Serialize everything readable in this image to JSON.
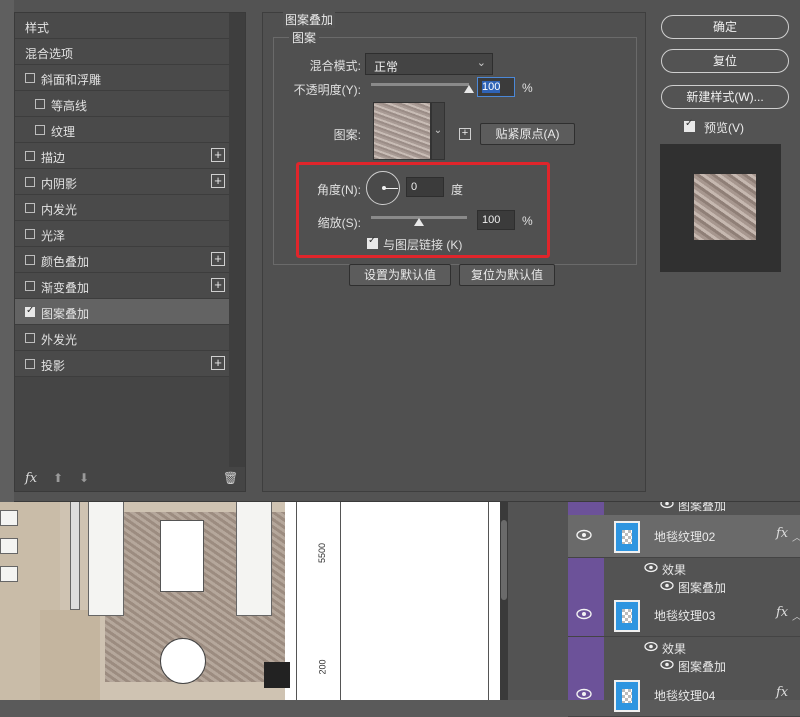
{
  "canvas": {
    "dimension_labels": [
      "5500",
      "200"
    ]
  },
  "layers": {
    "items": [
      {
        "name": "地毯纹理02",
        "fx": "fx",
        "effects_label": "效果",
        "effect": "图案叠加"
      },
      {
        "name": "地毯纹理03",
        "fx": "fx",
        "effects_label": "效果",
        "effect": "图案叠加"
      },
      {
        "name": "地毯纹理04",
        "fx": "fx"
      }
    ],
    "top_partial_effect": "图案叠加"
  },
  "styles_list": {
    "items": [
      {
        "label": "样式",
        "checkbox": "none",
        "plus": false,
        "indent": 0
      },
      {
        "label": "混合选项",
        "checkbox": "none",
        "plus": false,
        "indent": 0
      },
      {
        "label": "斜面和浮雕",
        "checkbox": "unchecked",
        "plus": false,
        "indent": 0
      },
      {
        "label": "等高线",
        "checkbox": "unchecked",
        "plus": false,
        "indent": 1
      },
      {
        "label": "纹理",
        "checkbox": "unchecked",
        "plus": false,
        "indent": 1
      },
      {
        "label": "描边",
        "checkbox": "unchecked",
        "plus": true,
        "indent": 0
      },
      {
        "label": "内阴影",
        "checkbox": "unchecked",
        "plus": true,
        "indent": 0
      },
      {
        "label": "内发光",
        "checkbox": "unchecked",
        "plus": false,
        "indent": 0
      },
      {
        "label": "光泽",
        "checkbox": "unchecked",
        "plus": false,
        "indent": 0
      },
      {
        "label": "颜色叠加",
        "checkbox": "unchecked",
        "plus": true,
        "indent": 0
      },
      {
        "label": "渐变叠加",
        "checkbox": "unchecked",
        "plus": true,
        "indent": 0
      },
      {
        "label": "图案叠加",
        "checkbox": "checked",
        "plus": false,
        "indent": 0,
        "active": true
      },
      {
        "label": "外发光",
        "checkbox": "unchecked",
        "plus": false,
        "indent": 0
      },
      {
        "label": "投影",
        "checkbox": "unchecked",
        "plus": true,
        "indent": 0
      }
    ],
    "footer": {
      "fx": "fx",
      "up": "⬆",
      "down": "⬇",
      "trash": "🗑"
    }
  },
  "settings": {
    "group_title": "图案叠加",
    "fieldset_title": "图案",
    "blend_mode_label": "混合模式:",
    "blend_mode_value": "正常",
    "opacity_label": "不透明度(Y):",
    "opacity_value": "100",
    "opacity_unit": "%",
    "opacity_fraction": 1.0,
    "pattern_label": "图案:",
    "snap_origin_button": "贴紧原点(A)",
    "angle_label": "角度(N):",
    "angle_value": "0",
    "angle_unit": "度",
    "scale_label": "缩放(S):",
    "scale_value": "100",
    "scale_unit": "%",
    "link_label": "与图层链接 (K)",
    "link_checked": true,
    "set_default_button": "设置为默认值",
    "reset_default_button": "复位为默认值"
  },
  "actions": {
    "ok": "确定",
    "reset": "复位",
    "new_style": "新建样式(W)...",
    "preview_label": "预览(V)",
    "preview_checked": true
  },
  "colors": {
    "highlight_red": "#e0252b",
    "layer_color_tag": "#6c5299",
    "layer_thumb": "#2e95e0"
  }
}
